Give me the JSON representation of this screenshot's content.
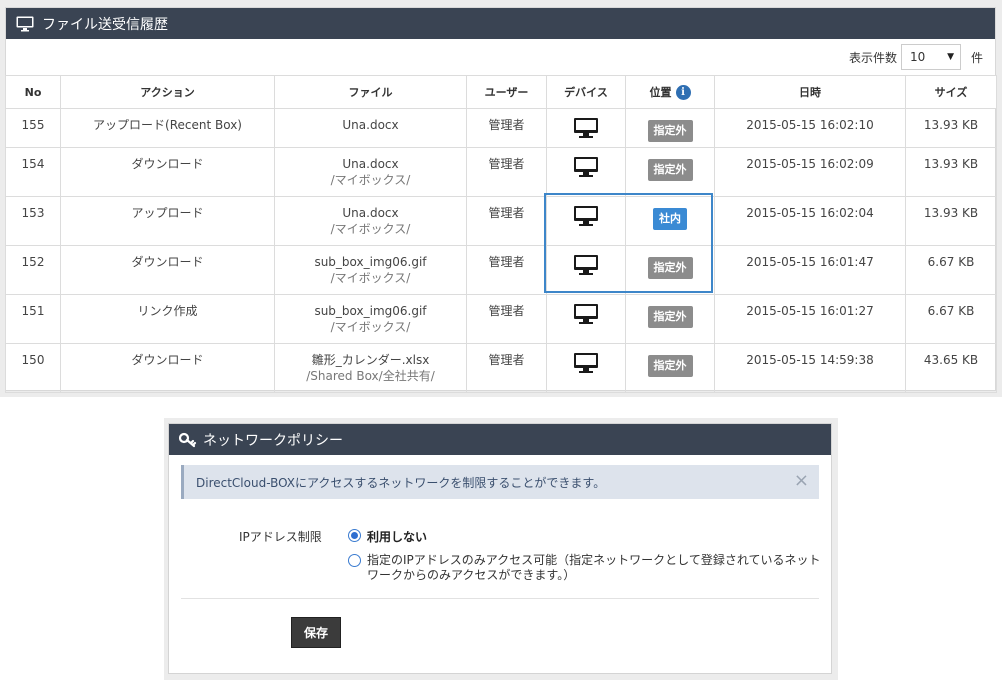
{
  "history": {
    "title": "ファイル送受信履歴",
    "per_page_label": "表示件数",
    "per_page_value": "10",
    "per_page_unit": "件",
    "columns": [
      "No",
      "アクション",
      "ファイル",
      "ユーザー",
      "デバイス",
      "位置",
      "日時",
      "サイズ"
    ],
    "rows": [
      {
        "no": "155",
        "action": "アップロード(Recent Box)",
        "file": "Una.docx",
        "path": "",
        "user": "管理者",
        "location": "指定外",
        "location_type": "out",
        "datetime": "2015-05-15 16:02:10",
        "size": "13.93 KB"
      },
      {
        "no": "154",
        "action": "ダウンロード",
        "file": "Una.docx",
        "path": "/マイボックス/",
        "user": "管理者",
        "location": "指定外",
        "location_type": "out",
        "datetime": "2015-05-15 16:02:09",
        "size": "13.93 KB"
      },
      {
        "no": "153",
        "action": "アップロード",
        "file": "Una.docx",
        "path": "/マイボックス/",
        "user": "管理者",
        "location": "社内",
        "location_type": "in",
        "datetime": "2015-05-15 16:02:04",
        "size": "13.93 KB"
      },
      {
        "no": "152",
        "action": "ダウンロード",
        "file": "sub_box_img06.gif",
        "path": "/マイボックス/",
        "user": "管理者",
        "location": "指定外",
        "location_type": "out",
        "datetime": "2015-05-15 16:01:47",
        "size": "6.67 KB"
      },
      {
        "no": "151",
        "action": "リンク作成",
        "file": "sub_box_img06.gif",
        "path": "/マイボックス/",
        "user": "管理者",
        "location": "指定外",
        "location_type": "out",
        "datetime": "2015-05-15 16:01:27",
        "size": "6.67 KB"
      },
      {
        "no": "150",
        "action": "ダウンロード",
        "file": "雛形_カレンダー.xlsx",
        "path": "/Shared Box/全社共有/",
        "user": "管理者",
        "location": "指定外",
        "location_type": "out",
        "datetime": "2015-05-15 14:59:38",
        "size": "43.65 KB"
      }
    ]
  },
  "network": {
    "title": "ネットワークポリシー",
    "alert": "DirectCloud-BOXにアクセスするネットワークを制限することができます。",
    "ip_label": "IPアドレス制限",
    "option_none": "利用しない",
    "option_restrict": "指定のIPアドレスのみアクセス可能（指定ネットワークとして登録されているネットワークからのみアクセスができます。）",
    "selected": "none",
    "save_label": "保存"
  },
  "colors": {
    "header_bg": "#3a4453",
    "badge_out": "#8c8c8c",
    "badge_in": "#3a8ad4",
    "highlight": "#3d86c9"
  }
}
